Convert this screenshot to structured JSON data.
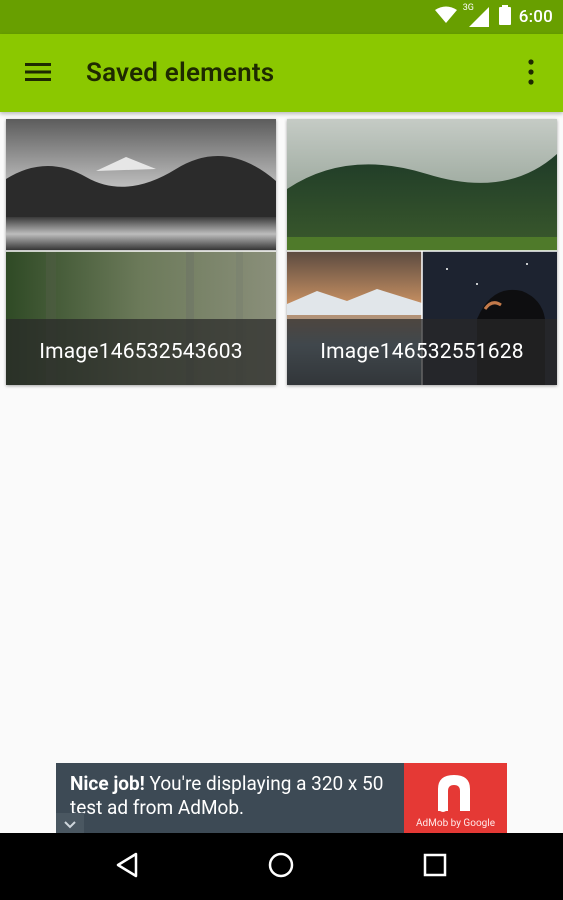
{
  "status_bar": {
    "time": "6:00",
    "network_label": "3G",
    "icons": [
      "wifi-icon",
      "cell-signal-icon",
      "battery-icon"
    ],
    "background": "#689f00"
  },
  "app_bar": {
    "title": "Saved elements",
    "menu_icon": "hamburger-menu-icon",
    "overflow_icon": "more-vert-icon",
    "background": "#8bc800"
  },
  "saved_items": [
    {
      "name": "Image146532543603"
    },
    {
      "name": "Image146532551628"
    }
  ],
  "ad_banner": {
    "headline": "Nice job!",
    "body": " You're displaying a 320 x 50 test ad from AdMob.",
    "logo_label": "AdMob by Google",
    "background": "#3d4a55",
    "logo_background": "#e53935"
  },
  "nav_bar": {
    "icons": [
      "back-icon",
      "home-icon",
      "recents-icon"
    ]
  }
}
